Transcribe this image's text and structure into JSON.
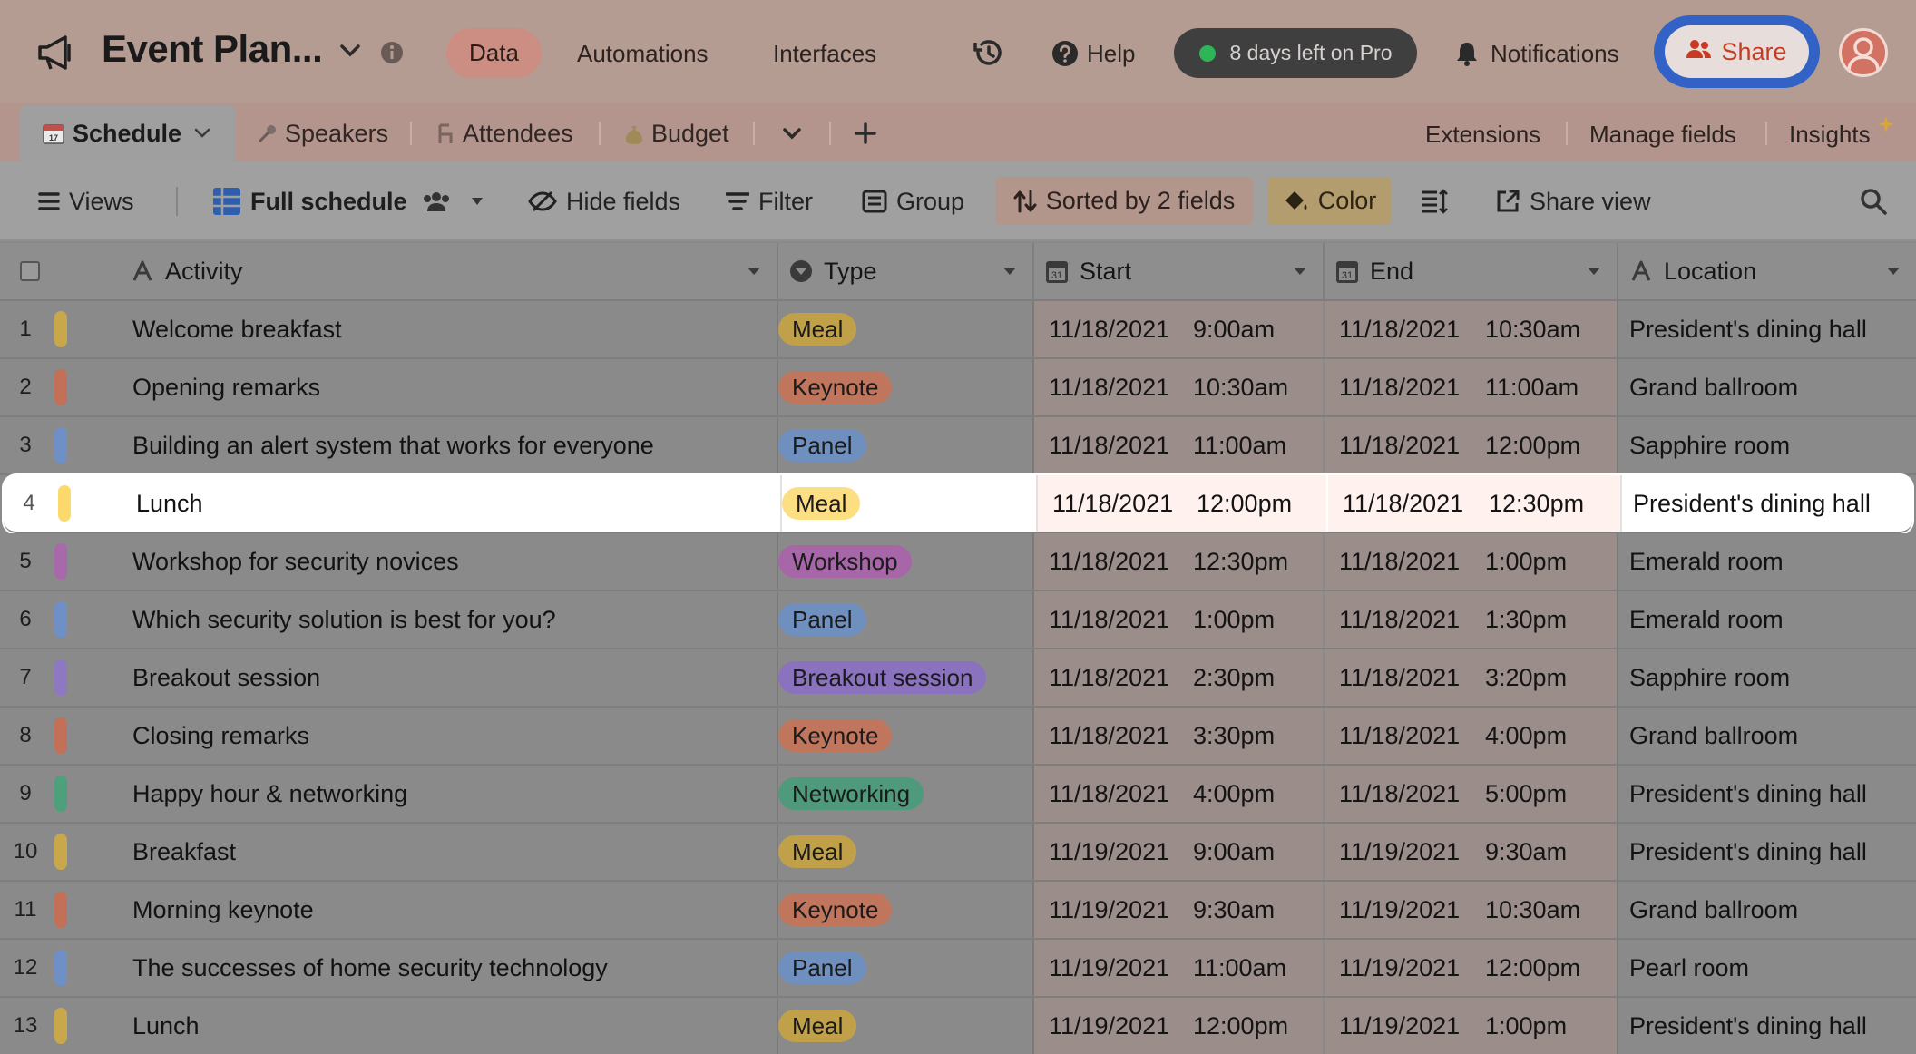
{
  "app": {
    "base_title": "Event Plan...",
    "nav": {
      "data": "Data",
      "automations": "Automations",
      "interfaces": "Interfaces"
    },
    "help": "Help",
    "pro_status": "8 days left on Pro",
    "notifications": "Notifications",
    "share": "Share",
    "colors": {
      "share_ring": "#3262c5",
      "share_text": "#c83b22",
      "pro_dot": "#2fb457"
    }
  },
  "tables": {
    "active": "Schedule",
    "items": [
      "Speakers",
      "Attendees",
      "Budget"
    ],
    "right_links": {
      "extensions": "Extensions",
      "manage_fields": "Manage fields",
      "insights": "Insights"
    }
  },
  "toolbar": {
    "views": "Views",
    "view_name": "Full schedule",
    "hide_fields": "Hide fields",
    "filter": "Filter",
    "group": "Group",
    "sort": "Sorted by 2 fields",
    "color": "Color",
    "share_view": "Share view"
  },
  "columns": {
    "activity": "Activity",
    "type": "Type",
    "start": "Start",
    "end": "End",
    "location": "Location"
  },
  "type_colors": {
    "Meal": {
      "bg": "#c0a14a",
      "bar": "#c8a84a"
    },
    "Keynote": {
      "bg": "#c0755d",
      "bar": "#c27058"
    },
    "Panel": {
      "bg": "#6f8fbf",
      "bar": "#6f90c6"
    },
    "Workshop": {
      "bg": "#a766a8",
      "bar": "#a869aa"
    },
    "Breakout session": {
      "bg": "#8a72bf",
      "bar": "#8f78c2"
    },
    "Networking": {
      "bg": "#4f9a7c",
      "bar": "#4ea07c"
    }
  },
  "highlight_colors": {
    "Meal": {
      "bg": "#fbdf82",
      "bar": "#fbd96a"
    }
  },
  "rows": [
    {
      "num": "1",
      "activity": "Welcome breakfast",
      "type": "Meal",
      "start_date": "11/18/2021",
      "start_time": "9:00am",
      "end_date": "11/18/2021",
      "end_time": "10:30am",
      "location": "President's dining hall"
    },
    {
      "num": "2",
      "activity": "Opening remarks",
      "type": "Keynote",
      "start_date": "11/18/2021",
      "start_time": "10:30am",
      "end_date": "11/18/2021",
      "end_time": "11:00am",
      "location": "Grand ballroom"
    },
    {
      "num": "3",
      "activity": "Building an alert system that works for everyone",
      "type": "Panel",
      "start_date": "11/18/2021",
      "start_time": "11:00am",
      "end_date": "11/18/2021",
      "end_time": "12:00pm",
      "location": "Sapphire room"
    },
    {
      "num": "4",
      "activity": "Lunch",
      "type": "Meal",
      "start_date": "11/18/2021",
      "start_time": "12:00pm",
      "end_date": "11/18/2021",
      "end_time": "12:30pm",
      "location": "President's dining hall",
      "highlighted": true
    },
    {
      "num": "5",
      "activity": "Workshop for security novices",
      "type": "Workshop",
      "start_date": "11/18/2021",
      "start_time": "12:30pm",
      "end_date": "11/18/2021",
      "end_time": "1:00pm",
      "location": "Emerald room"
    },
    {
      "num": "6",
      "activity": "Which security solution is best for you?",
      "type": "Panel",
      "start_date": "11/18/2021",
      "start_time": "1:00pm",
      "end_date": "11/18/2021",
      "end_time": "1:30pm",
      "location": "Emerald room"
    },
    {
      "num": "7",
      "activity": "Breakout session",
      "type": "Breakout session",
      "start_date": "11/18/2021",
      "start_time": "2:30pm",
      "end_date": "11/18/2021",
      "end_time": "3:20pm",
      "location": "Sapphire room"
    },
    {
      "num": "8",
      "activity": "Closing remarks",
      "type": "Keynote",
      "start_date": "11/18/2021",
      "start_time": "3:30pm",
      "end_date": "11/18/2021",
      "end_time": "4:00pm",
      "location": "Grand ballroom"
    },
    {
      "num": "9",
      "activity": "Happy hour & networking",
      "type": "Networking",
      "start_date": "11/18/2021",
      "start_time": "4:00pm",
      "end_date": "11/18/2021",
      "end_time": "5:00pm",
      "location": "President's dining hall"
    },
    {
      "num": "10",
      "activity": "Breakfast",
      "type": "Meal",
      "start_date": "11/19/2021",
      "start_time": "9:00am",
      "end_date": "11/19/2021",
      "end_time": "9:30am",
      "location": "President's dining hall"
    },
    {
      "num": "11",
      "activity": "Morning keynote",
      "type": "Keynote",
      "start_date": "11/19/2021",
      "start_time": "9:30am",
      "end_date": "11/19/2021",
      "end_time": "10:30am",
      "location": "Grand ballroom"
    },
    {
      "num": "12",
      "activity": "The successes of home security technology",
      "type": "Panel",
      "start_date": "11/19/2021",
      "start_time": "11:00am",
      "end_date": "11/19/2021",
      "end_time": "12:00pm",
      "location": "Pearl room"
    },
    {
      "num": "13",
      "activity": "Lunch",
      "type": "Meal",
      "start_date": "11/19/2021",
      "start_time": "12:00pm",
      "end_date": "11/19/2021",
      "end_time": "1:00pm",
      "location": "President's dining hall"
    }
  ]
}
